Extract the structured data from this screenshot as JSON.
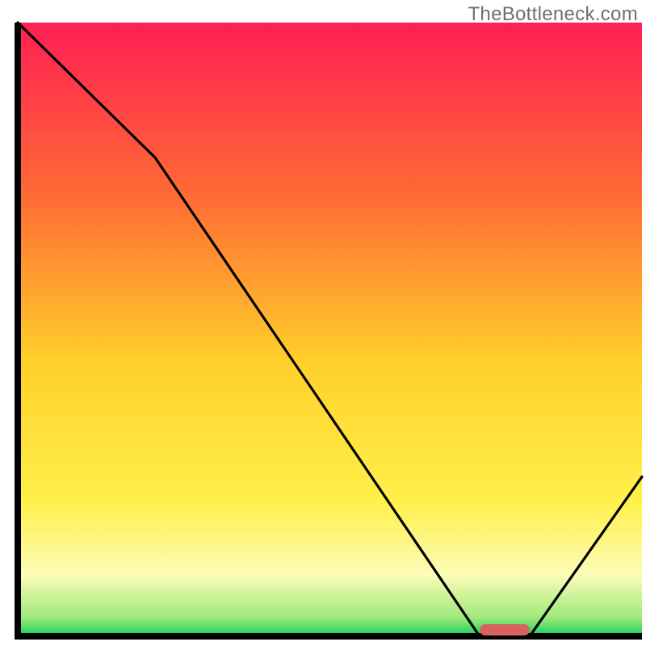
{
  "watermark": "TheBottleneck.com",
  "chart_data": {
    "type": "line",
    "title": "",
    "xlabel": "",
    "ylabel": "",
    "xlim": [
      0,
      100
    ],
    "ylim": [
      0,
      100
    ],
    "grid": false,
    "series": [
      {
        "name": "bottleneck-curve",
        "x": [
          0,
          22,
          74,
          82,
          100
        ],
        "y": [
          100,
          78,
          0,
          0,
          26
        ]
      }
    ],
    "marker": {
      "x_range": [
        74,
        82
      ],
      "y": 0,
      "color": "#d9625f"
    }
  },
  "colors": {
    "gradient_top": "#ff1f54",
    "gradient_mid1": "#ff8a2a",
    "gradient_mid2": "#ffe52a",
    "gradient_mid3": "#fffb9a",
    "gradient_bottom": "#10d060",
    "curve": "#000000",
    "axis": "#000000",
    "marker": "#d9625f"
  },
  "geometry": {
    "plot_left": 22,
    "plot_top": 28,
    "plot_right": 795,
    "plot_bottom": 788,
    "marker_height": 14,
    "marker_radius": 7
  }
}
